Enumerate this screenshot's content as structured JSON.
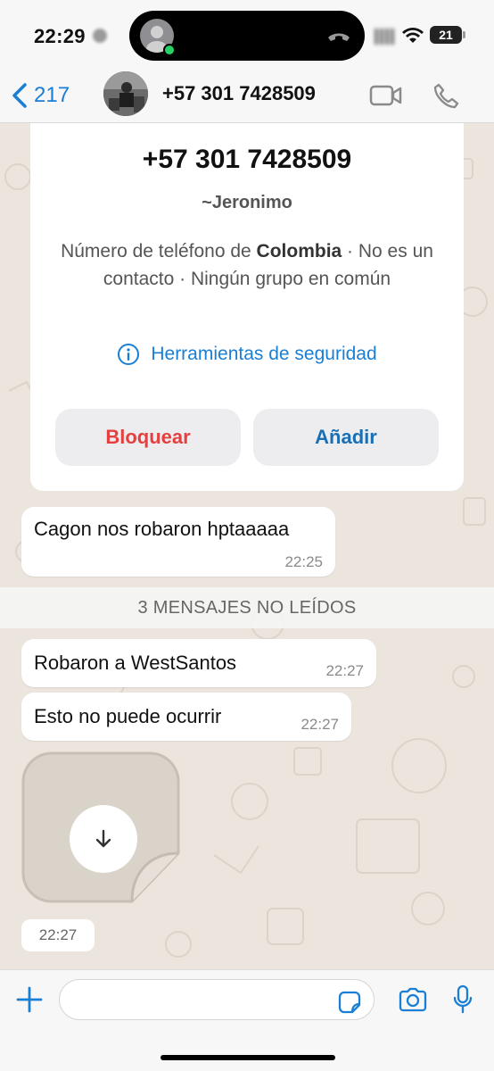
{
  "status_bar": {
    "time": "22:29",
    "battery": "21"
  },
  "header": {
    "back_count": "217",
    "title": "+57 301 7428509"
  },
  "info_card": {
    "number": "+57 301 7428509",
    "name": "~Jeronimo",
    "desc_prefix": "Número de teléfono de ",
    "desc_country": "Colombia",
    "desc_suffix": " · No es un contacto · Ningún grupo en común",
    "security_label": "Herramientas de seguridad",
    "block_label": "Bloquear",
    "add_label": "Añadir"
  },
  "messages": [
    {
      "text": "Cagon nos robaron hptaaaaa",
      "time": "22:25"
    },
    {
      "text": "Robaron a WestSantos",
      "time": "22:27"
    },
    {
      "text": "Esto no puede ocurrir",
      "time": "22:27"
    }
  ],
  "unread_banner": "3 MENSAJES NO LEÍDOS",
  "sticker": {
    "time": "22:27"
  },
  "colors": {
    "accent": "#1a7fd4",
    "block": "#e54040",
    "add": "#1a6fb4",
    "wallpaper": "#ece5dd"
  },
  "icons": [
    "chevron-left-icon",
    "video-icon",
    "phone-icon",
    "info-icon",
    "download-icon",
    "plus-icon",
    "sticker-icon",
    "camera-icon",
    "mic-icon",
    "wifi-icon"
  ]
}
